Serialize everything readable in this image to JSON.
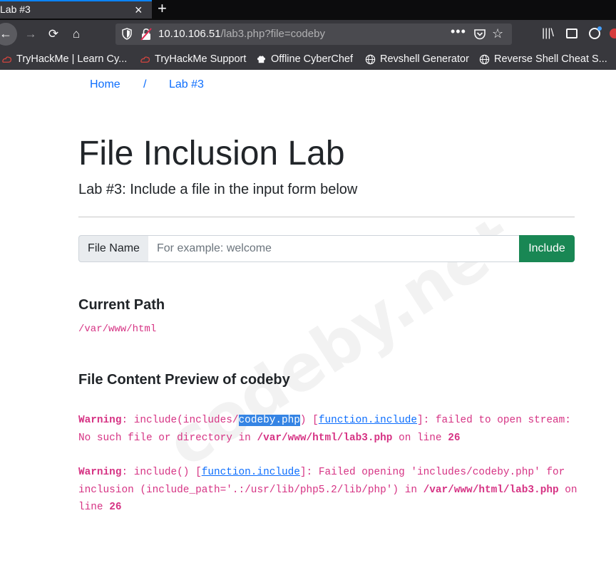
{
  "browser": {
    "tab": {
      "title": "Lab #3",
      "close": "×"
    },
    "new_tab": "+",
    "nav": {
      "back": "←",
      "forward": "→",
      "reload": "⟳",
      "home": "⌂"
    },
    "url": {
      "host": "10.10.106.51",
      "path": "/lab3.php?file=codeby"
    },
    "url_actions": {
      "more": "•••",
      "star": "☆"
    },
    "toolbar": {
      "library": "|||\\"
    },
    "bookmarks": [
      {
        "label": "TryHackMe | Learn Cy...",
        "icon": "tryhackme-icon"
      },
      {
        "label": "TryHackMe Support",
        "icon": "tryhackme-icon"
      },
      {
        "label": "Offline CyberChef",
        "icon": "chef-hat-icon"
      },
      {
        "label": "Revshell Generator",
        "icon": "globe-icon"
      },
      {
        "label": "Reverse Shell Cheat S...",
        "icon": "globe-icon"
      }
    ]
  },
  "page": {
    "breadcrumb": {
      "home": "Home",
      "separator": "/",
      "current": "Lab #3"
    },
    "title": "File Inclusion Lab",
    "lead": "Lab #3: Include a file in the input form below",
    "form": {
      "label": "File Name",
      "placeholder": "For example: welcome",
      "value": "",
      "button": "Include"
    },
    "current_path": {
      "heading": "Current Path",
      "value": "/var/www/html"
    },
    "preview": {
      "heading_prefix": "File Content Preview of ",
      "file": "codeby"
    },
    "warning1": {
      "label": "Warning",
      "p1": ": include(includes/",
      "highlight": "codeby.php",
      "p2": ") [",
      "link": "function.include",
      "p3": "]: failed to open stream: No such file or directory in ",
      "file": "/var/www/html/lab3.php",
      "p4": " on line ",
      "line": "26"
    },
    "warning2": {
      "label": "Warning",
      "p1": ": include() [",
      "link": "function.include",
      "p2": "]: Failed opening 'includes/codeby.php' for inclusion (include_path='.:/usr/lib/php5.2/lib/php') in ",
      "file": "/var/www/html/lab3.php",
      "p3": " on line ",
      "line": "26"
    },
    "watermark": "codeby.net"
  }
}
